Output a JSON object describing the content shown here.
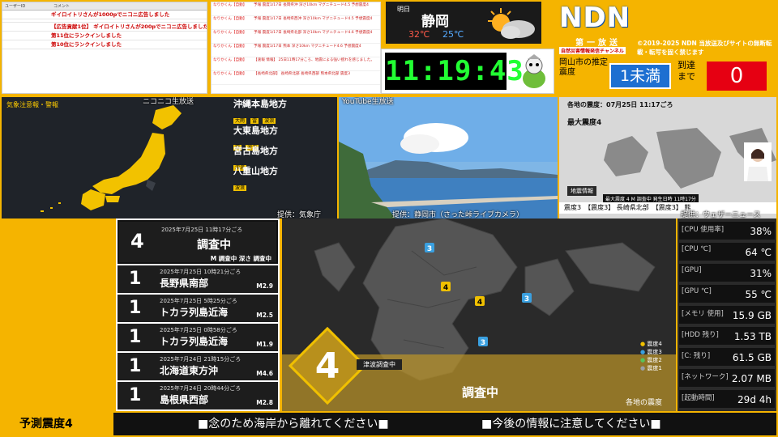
{
  "comments": {
    "headers": [
      "ユーザーID",
      "コメント"
    ],
    "rows": [
      "ギイロイトリさんが1000pでニコニ広告しました",
      "【広告貢献1位】 ギイロイトリさんが200pでニコニ広告しました",
      "第11位にランクインしました",
      "第10位にランクインしました"
    ]
  },
  "youtube_chat": {
    "user": "なりかくん【自動】",
    "rows": [
      "予報 震度1/17日 長岡県沖 深さ10km マグニチュード4.5 予想震度4",
      "予報 震度1/17日 長崎県西沖 深さ10km マグニチュード4.5 予想震度4",
      "予報 震度1/17日 長崎県北部 深さ10km マグニチュード4.6 予想震度4",
      "予報 震度1/17日 熊本 深さ10km マグニチュード4.6 予想震度4",
      "【速報 情報】 25日11時17分ころ、地震による強い揺れを感じました。",
      "【長崎県北部】 長崎県北部 長崎県西部 熊本県北部 震度3"
    ]
  },
  "weather": {
    "day": "明日",
    "city": "静岡",
    "high": "32℃",
    "low": "25℃"
  },
  "clock": {
    "time": "11:19:43"
  },
  "ndn": {
    "logo": "NDN",
    "subtitle": "第一放送",
    "tagline": "自然災害情報発信チャンネル",
    "copyright": "©2019-2025 NDN 当放送及びサイトの無断転載・転写を固く禁じます",
    "city_label": "岡山市の推定震度",
    "city_intensity": "1未満",
    "arrival_label": "到達まで",
    "arrival_value": "0"
  },
  "warning_map": {
    "title": "気象注意報・警報",
    "regions": [
      {
        "name": "沖縄本島地方",
        "tags": [
          "大雨",
          "雷",
          "波浪"
        ]
      },
      {
        "name": "大東島地方",
        "tags": [
          "雷",
          "波浪"
        ]
      },
      {
        "name": "宮古島地方",
        "tags": [
          "波浪"
        ]
      },
      {
        "name": "八重山地方",
        "tags": [
          "波浪"
        ]
      }
    ],
    "source": "提供：気象庁",
    "overlay": "ニコニコ生放送",
    "colors": {
      "land": "#3a3f47",
      "warn": "#f2c200"
    }
  },
  "camera": {
    "overlay": "YouTube生放送",
    "source": "提供：静岡市（さった峠ライブカメラ）"
  },
  "news": {
    "header": "各地の震度：07月25日 11:17ごろ",
    "max": "最大震度4",
    "box_label": "地震情報",
    "strip": "最大震度 4 M 調査中 発生日時 11時17分",
    "bottom": "震度3　【震度3】 長崎県北部　【震度3】 熊",
    "source": "提供：ウェザーニュース"
  },
  "quake_main": {
    "intensity": "4",
    "datetime": "2025年7月25日 11時17分ごろ",
    "place": "調査中",
    "detail": "M 調査中 深さ 調査中"
  },
  "quakes": [
    {
      "intensity": "1",
      "datetime": "2025年7月25日 10時21分ごろ",
      "place": "長野県南部",
      "mag": "M2.9"
    },
    {
      "intensity": "1",
      "datetime": "2025年7月25日 5時25分ごろ",
      "place": "トカラ列島近海",
      "mag": "M2.5"
    },
    {
      "intensity": "1",
      "datetime": "2025年7月25日 0時58分ごろ",
      "place": "トカラ列島近海",
      "mag": "M1.9"
    },
    {
      "intensity": "1",
      "datetime": "2025年7月24日 21時15分ごろ",
      "place": "北海道東方沖",
      "mag": "M4.6"
    },
    {
      "intensity": "1",
      "datetime": "2025年7月24日 20時44分ごろ",
      "place": "島根県西部",
      "mag": "M2.8"
    }
  ],
  "intensity_map": {
    "big_intensity": "4",
    "tsunami": "津波調査中",
    "status": "調査中",
    "caption": "各地の震度",
    "legend": [
      "震度4",
      "震度3",
      "震度2",
      "震度1"
    ],
    "colors": {
      "s4": "#f0c000",
      "s3": "#3aa0e0",
      "s2": "#57c35a",
      "s1": "#9aa0a6"
    },
    "markers": [
      "3",
      "4",
      "4",
      "3",
      "3"
    ]
  },
  "system": [
    {
      "label": "[CPU 使用率]",
      "value": "38%"
    },
    {
      "label": "[CPU ℃]",
      "value": "64 ℃"
    },
    {
      "label": "[GPU]",
      "value": "31%"
    },
    {
      "label": "[GPU ℃]",
      "value": "55 ℃"
    },
    {
      "label": "[メモリ 使用]",
      "value": "15.9 GB"
    },
    {
      "label": "[HDD 残り]",
      "value": "1.53 TB"
    },
    {
      "label": "[C: 残り]",
      "value": "61.5 GB"
    },
    {
      "label": "[ネットワーク]",
      "value": "2.07 MB"
    },
    {
      "label": "[起動時間]",
      "value": "29d 4h"
    }
  ],
  "forecast": "予測震度4",
  "ticker": {
    "msg1": "■念のため海岸から離れてください■",
    "msg2": "■今後の情報に注意してください■"
  }
}
